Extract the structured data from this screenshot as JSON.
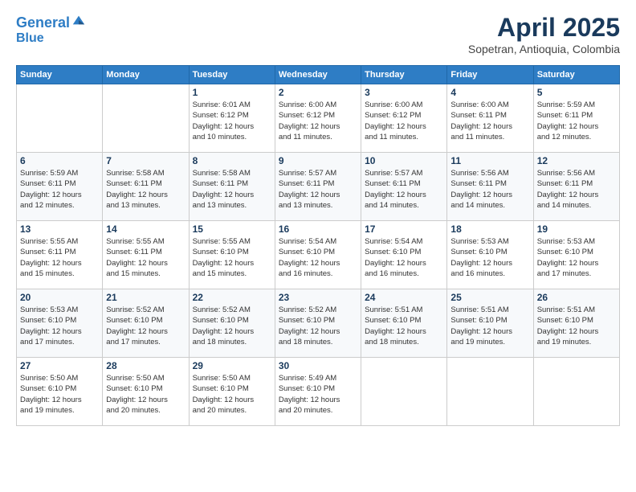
{
  "logo": {
    "line1": "General",
    "line2": "Blue"
  },
  "header": {
    "title": "April 2025",
    "subtitle": "Sopetran, Antioquia, Colombia"
  },
  "weekdays": [
    "Sunday",
    "Monday",
    "Tuesday",
    "Wednesday",
    "Thursday",
    "Friday",
    "Saturday"
  ],
  "weeks": [
    [
      {
        "day": "",
        "info": ""
      },
      {
        "day": "",
        "info": ""
      },
      {
        "day": "1",
        "info": "Sunrise: 6:01 AM\nSunset: 6:12 PM\nDaylight: 12 hours\nand 10 minutes."
      },
      {
        "day": "2",
        "info": "Sunrise: 6:00 AM\nSunset: 6:12 PM\nDaylight: 12 hours\nand 11 minutes."
      },
      {
        "day": "3",
        "info": "Sunrise: 6:00 AM\nSunset: 6:12 PM\nDaylight: 12 hours\nand 11 minutes."
      },
      {
        "day": "4",
        "info": "Sunrise: 6:00 AM\nSunset: 6:11 PM\nDaylight: 12 hours\nand 11 minutes."
      },
      {
        "day": "5",
        "info": "Sunrise: 5:59 AM\nSunset: 6:11 PM\nDaylight: 12 hours\nand 12 minutes."
      }
    ],
    [
      {
        "day": "6",
        "info": "Sunrise: 5:59 AM\nSunset: 6:11 PM\nDaylight: 12 hours\nand 12 minutes."
      },
      {
        "day": "7",
        "info": "Sunrise: 5:58 AM\nSunset: 6:11 PM\nDaylight: 12 hours\nand 13 minutes."
      },
      {
        "day": "8",
        "info": "Sunrise: 5:58 AM\nSunset: 6:11 PM\nDaylight: 12 hours\nand 13 minutes."
      },
      {
        "day": "9",
        "info": "Sunrise: 5:57 AM\nSunset: 6:11 PM\nDaylight: 12 hours\nand 13 minutes."
      },
      {
        "day": "10",
        "info": "Sunrise: 5:57 AM\nSunset: 6:11 PM\nDaylight: 12 hours\nand 14 minutes."
      },
      {
        "day": "11",
        "info": "Sunrise: 5:56 AM\nSunset: 6:11 PM\nDaylight: 12 hours\nand 14 minutes."
      },
      {
        "day": "12",
        "info": "Sunrise: 5:56 AM\nSunset: 6:11 PM\nDaylight: 12 hours\nand 14 minutes."
      }
    ],
    [
      {
        "day": "13",
        "info": "Sunrise: 5:55 AM\nSunset: 6:11 PM\nDaylight: 12 hours\nand 15 minutes."
      },
      {
        "day": "14",
        "info": "Sunrise: 5:55 AM\nSunset: 6:11 PM\nDaylight: 12 hours\nand 15 minutes."
      },
      {
        "day": "15",
        "info": "Sunrise: 5:55 AM\nSunset: 6:10 PM\nDaylight: 12 hours\nand 15 minutes."
      },
      {
        "day": "16",
        "info": "Sunrise: 5:54 AM\nSunset: 6:10 PM\nDaylight: 12 hours\nand 16 minutes."
      },
      {
        "day": "17",
        "info": "Sunrise: 5:54 AM\nSunset: 6:10 PM\nDaylight: 12 hours\nand 16 minutes."
      },
      {
        "day": "18",
        "info": "Sunrise: 5:53 AM\nSunset: 6:10 PM\nDaylight: 12 hours\nand 16 minutes."
      },
      {
        "day": "19",
        "info": "Sunrise: 5:53 AM\nSunset: 6:10 PM\nDaylight: 12 hours\nand 17 minutes."
      }
    ],
    [
      {
        "day": "20",
        "info": "Sunrise: 5:53 AM\nSunset: 6:10 PM\nDaylight: 12 hours\nand 17 minutes."
      },
      {
        "day": "21",
        "info": "Sunrise: 5:52 AM\nSunset: 6:10 PM\nDaylight: 12 hours\nand 17 minutes."
      },
      {
        "day": "22",
        "info": "Sunrise: 5:52 AM\nSunset: 6:10 PM\nDaylight: 12 hours\nand 18 minutes."
      },
      {
        "day": "23",
        "info": "Sunrise: 5:52 AM\nSunset: 6:10 PM\nDaylight: 12 hours\nand 18 minutes."
      },
      {
        "day": "24",
        "info": "Sunrise: 5:51 AM\nSunset: 6:10 PM\nDaylight: 12 hours\nand 18 minutes."
      },
      {
        "day": "25",
        "info": "Sunrise: 5:51 AM\nSunset: 6:10 PM\nDaylight: 12 hours\nand 19 minutes."
      },
      {
        "day": "26",
        "info": "Sunrise: 5:51 AM\nSunset: 6:10 PM\nDaylight: 12 hours\nand 19 minutes."
      }
    ],
    [
      {
        "day": "27",
        "info": "Sunrise: 5:50 AM\nSunset: 6:10 PM\nDaylight: 12 hours\nand 19 minutes."
      },
      {
        "day": "28",
        "info": "Sunrise: 5:50 AM\nSunset: 6:10 PM\nDaylight: 12 hours\nand 20 minutes."
      },
      {
        "day": "29",
        "info": "Sunrise: 5:50 AM\nSunset: 6:10 PM\nDaylight: 12 hours\nand 20 minutes."
      },
      {
        "day": "30",
        "info": "Sunrise: 5:49 AM\nSunset: 6:10 PM\nDaylight: 12 hours\nand 20 minutes."
      },
      {
        "day": "",
        "info": ""
      },
      {
        "day": "",
        "info": ""
      },
      {
        "day": "",
        "info": ""
      }
    ]
  ]
}
